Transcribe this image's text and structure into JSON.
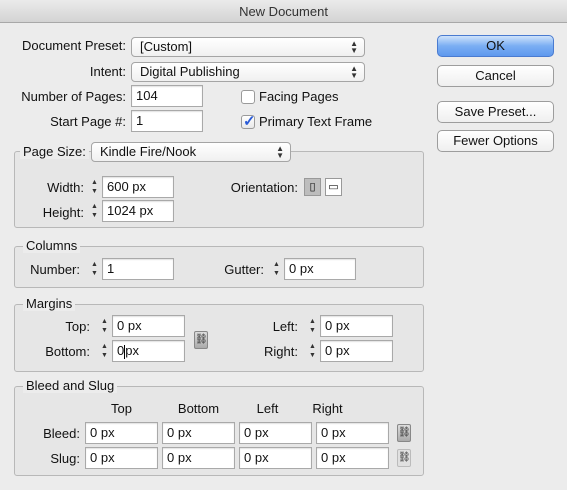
{
  "window": {
    "title": "New Document"
  },
  "preset": {
    "label": "Document Preset:",
    "value": "[Custom]"
  },
  "intent": {
    "label": "Intent:",
    "value": "Digital Publishing"
  },
  "pages": {
    "label": "Number of Pages:",
    "value": "104"
  },
  "start_page": {
    "label": "Start Page #:",
    "value": "1"
  },
  "facing_pages": {
    "label": "Facing Pages",
    "checked": false
  },
  "primary_text_frame": {
    "label": "Primary Text Frame",
    "checked": true
  },
  "buttons": {
    "ok": "OK",
    "cancel": "Cancel",
    "save_preset": "Save Preset...",
    "fewer_options": "Fewer Options"
  },
  "page_size": {
    "label": "Page Size:",
    "value": "Kindle Fire/Nook",
    "width_label": "Width:",
    "width": "600 px",
    "height_label": "Height:",
    "height": "1024 px",
    "orientation_label": "Orientation:"
  },
  "columns": {
    "title": "Columns",
    "number_label": "Number:",
    "number": "1",
    "gutter_label": "Gutter:",
    "gutter": "0 px"
  },
  "margins": {
    "title": "Margins",
    "top_label": "Top:",
    "top": "0 px",
    "bottom_label": "Bottom:",
    "bottom_a": "0",
    "bottom_b": "px",
    "left_label": "Left:",
    "left": "0 px",
    "right_label": "Right:",
    "right": "0 px"
  },
  "bleed_slug": {
    "title": "Bleed and Slug",
    "headers": [
      "Top",
      "Bottom",
      "Left",
      "Right"
    ],
    "bleed_label": "Bleed:",
    "bleed": [
      "0 px",
      "0 px",
      "0 px",
      "0 px"
    ],
    "slug_label": "Slug:",
    "slug": [
      "0 px",
      "0 px",
      "0 px",
      "0 px"
    ]
  },
  "icons": {
    "popup_arrows": "up-down-arrows-icon",
    "stepper": "stepper-icon",
    "chain": "chain-link-icon",
    "portrait": "portrait-page-icon",
    "landscape": "landscape-page-icon"
  },
  "colors": {
    "primary_button": "#6aa2f0",
    "checkmark": "#2a5bd7"
  }
}
